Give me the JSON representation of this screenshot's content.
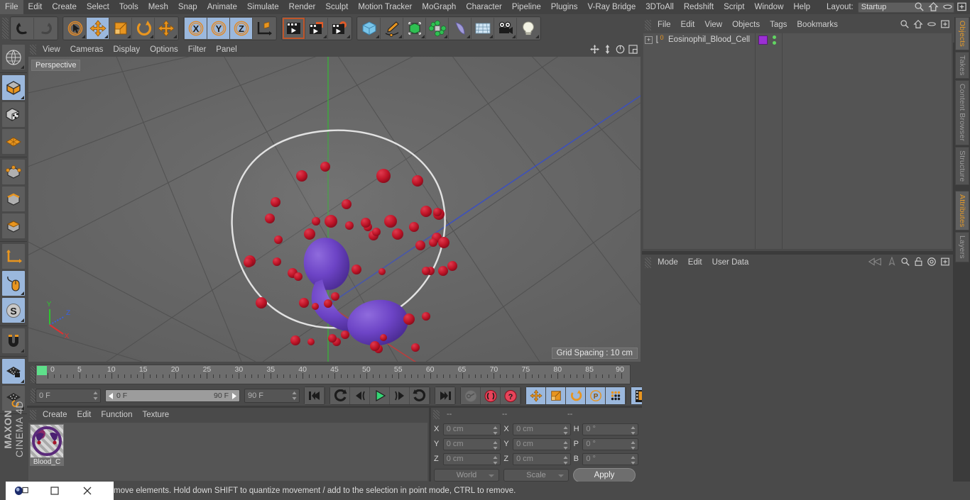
{
  "app": {
    "title": "MAXON CINEMA 4D",
    "brand_line1": "MAXON",
    "brand_line2": "CINEMA 4D"
  },
  "menubar": {
    "items": [
      {
        "label": "File"
      },
      {
        "label": "Edit"
      },
      {
        "label": "Create"
      },
      {
        "label": "Select"
      },
      {
        "label": "Tools"
      },
      {
        "label": "Mesh"
      },
      {
        "label": "Snap"
      },
      {
        "label": "Animate"
      },
      {
        "label": "Simulate"
      },
      {
        "label": "Render"
      },
      {
        "label": "Sculpt"
      },
      {
        "label": "Motion Tracker"
      },
      {
        "label": "MoGraph"
      },
      {
        "label": "Character"
      },
      {
        "label": "Pipeline"
      },
      {
        "label": "Plugins"
      },
      {
        "label": "V-Ray Bridge"
      },
      {
        "label": "3DToAll"
      },
      {
        "label": "Redshift"
      },
      {
        "label": "Script"
      },
      {
        "label": "Window"
      },
      {
        "label": "Help"
      }
    ],
    "layout_label": "Layout:",
    "layout_value": "Startup",
    "right_icons": [
      "search-icon",
      "home-icon",
      "capsule-icon",
      "layout-add-icon"
    ]
  },
  "toolbar": {
    "groups": [
      {
        "name": "history",
        "buttons": [
          {
            "icon": "undo-icon",
            "active": false
          },
          {
            "icon": "redo-icon",
            "active": false
          }
        ]
      },
      {
        "name": "selection-transform",
        "buttons": [
          {
            "icon": "live-selection-icon",
            "active": false
          },
          {
            "icon": "move-icon",
            "active": true
          },
          {
            "icon": "scale-icon",
            "active": false
          },
          {
            "icon": "rotate-icon",
            "active": false
          },
          {
            "icon": "move-alt-icon",
            "active": false
          }
        ]
      },
      {
        "name": "axis-locks",
        "buttons": [
          {
            "icon": "axis-x-icon",
            "active": true
          },
          {
            "icon": "axis-y-icon",
            "active": true
          },
          {
            "icon": "axis-z-icon",
            "active": true
          },
          {
            "icon": "world-object-axis-icon",
            "active": false
          }
        ]
      },
      {
        "name": "render",
        "buttons": [
          {
            "icon": "render-view-icon",
            "active": false
          },
          {
            "icon": "render-to-picture-viewer-icon",
            "active": false
          },
          {
            "icon": "render-settings-icon",
            "active": false
          }
        ]
      },
      {
        "name": "create",
        "buttons": [
          {
            "icon": "cube-primitive-icon",
            "active": false
          },
          {
            "icon": "spline-pen-icon",
            "active": false
          },
          {
            "icon": "nurbs-icon",
            "active": false
          },
          {
            "icon": "array-icon",
            "active": false
          },
          {
            "icon": "bend-deformer-icon",
            "active": false
          },
          {
            "icon": "floor-environment-icon",
            "active": false
          },
          {
            "icon": "camera-icon",
            "active": false
          },
          {
            "icon": "light-icon",
            "active": false
          }
        ]
      }
    ]
  },
  "left_palette": {
    "groups": [
      {
        "buttons": [
          {
            "icon": "make-editable-icon",
            "active": false
          }
        ]
      },
      {
        "buttons": [
          {
            "icon": "model-mode-icon",
            "active": true
          },
          {
            "icon": "texture-mode-icon",
            "active": false
          },
          {
            "icon": "workplane-mode-icon",
            "active": false
          }
        ]
      },
      {
        "buttons": [
          {
            "icon": "points-mode-icon",
            "active": false
          },
          {
            "icon": "edges-mode-icon",
            "active": false
          },
          {
            "icon": "polygons-mode-icon",
            "active": false
          }
        ]
      },
      {
        "buttons": [
          {
            "icon": "axis-modify-icon",
            "active": false
          },
          {
            "icon": "viewport-solo-mouse-icon",
            "active": true
          },
          {
            "icon": "enable-snapping-icon",
            "active": true
          }
        ]
      },
      {
        "buttons": [
          {
            "icon": "magnet-icon",
            "active": false
          }
        ]
      },
      {
        "buttons": [
          {
            "icon": "workplane-lock-icon",
            "active": true
          },
          {
            "icon": "workplane-rotate-icon",
            "active": false
          }
        ]
      }
    ]
  },
  "viewport": {
    "menu": [
      {
        "label": "View"
      },
      {
        "label": "Cameras"
      },
      {
        "label": "Display"
      },
      {
        "label": "Options"
      },
      {
        "label": "Filter"
      },
      {
        "label": "Panel"
      }
    ],
    "icons": [
      "pan-icon",
      "dolly-icon",
      "orbit-icon",
      "maximize-view-icon"
    ],
    "label": "Perspective",
    "grid_spacing": "Grid Spacing : 10 cm",
    "axis_gizmo": {
      "x": "X",
      "y": "Y",
      "z": "Z"
    },
    "scene": {
      "name": "Eosinophil Blood Cell",
      "nucleus_color": "#6b3fc4",
      "granule_color": "#c41830",
      "membrane_color": "#e8e8e8",
      "background_color": "#666666",
      "granule_count": 54
    }
  },
  "timeline": {
    "ruler_ticks": [
      0,
      5,
      10,
      15,
      20,
      25,
      30,
      35,
      40,
      45,
      50,
      55,
      60,
      65,
      70,
      75,
      80,
      85,
      90
    ],
    "current_frame_field": "0 F",
    "current_frame_right": "0 F",
    "range_start": "0 F",
    "range_end": "90 F",
    "max_frame": "90 F",
    "transport": [
      {
        "icon": "go-to-start-icon"
      },
      {
        "icon": "play-backwards-loop-icon"
      },
      {
        "icon": "step-back-icon"
      },
      {
        "icon": "play-icon"
      },
      {
        "icon": "step-forward-icon"
      },
      {
        "icon": "play-forward-loop-icon"
      },
      {
        "icon": "go-to-end-icon"
      }
    ],
    "keyframe_tools": [
      {
        "icon": "autokey-record-icon"
      },
      {
        "icon": "record-active-objects-icon"
      },
      {
        "icon": "keyframe-selection-icon"
      }
    ],
    "key_axis_tools": [
      {
        "icon": "position-key-icon",
        "active": true
      },
      {
        "icon": "scale-key-icon",
        "active": true
      },
      {
        "icon": "rotation-key-icon",
        "active": true
      },
      {
        "icon": "parameter-key-icon",
        "active": true
      },
      {
        "icon": "pla-key-icon",
        "active": true
      }
    ],
    "film_button": {
      "icon": "timeline-film-icon",
      "active": true
    }
  },
  "material_manager": {
    "menu": [
      {
        "label": "Create"
      },
      {
        "label": "Edit"
      },
      {
        "label": "Function"
      },
      {
        "label": "Texture"
      }
    ],
    "materials": [
      {
        "name": "Blood_C",
        "color": "#6b2f7a"
      }
    ]
  },
  "coordinates": {
    "header": [
      "--",
      "--",
      "--"
    ],
    "rows": [
      {
        "pos_label": "X",
        "pos_value": "0 cm",
        "size_label": "X",
        "size_value": "0 cm",
        "rot_label": "H",
        "rot_value": "0 °"
      },
      {
        "pos_label": "Y",
        "pos_value": "0 cm",
        "size_label": "Y",
        "size_value": "0 cm",
        "rot_label": "P",
        "rot_value": "0 °"
      },
      {
        "pos_label": "Z",
        "pos_value": "0 cm",
        "size_label": "Z",
        "size_value": "0 cm",
        "rot_label": "B",
        "rot_value": "0 °"
      }
    ],
    "space_dropdown": "World",
    "mode_dropdown": "Scale",
    "apply_button": "Apply"
  },
  "object_manager": {
    "menu": [
      {
        "label": "File"
      },
      {
        "label": "Edit"
      },
      {
        "label": "View"
      },
      {
        "label": "Objects"
      },
      {
        "label": "Tags"
      },
      {
        "label": "Bookmarks"
      }
    ],
    "icons": [
      "search-icon",
      "home-icon",
      "capsule-icon",
      "add-layer-icon"
    ],
    "objects": [
      {
        "name": "Eosinophil_Blood_Cell",
        "badge": "0",
        "material_color": "#9b2fd4",
        "visible_dots": 2
      }
    ]
  },
  "attributes": {
    "menu": [
      {
        "label": "Mode"
      },
      {
        "label": "Edit"
      },
      {
        "label": "User Data"
      }
    ],
    "icons": [
      "history-back-icon",
      "pin-icon",
      "search-icon",
      "lock-icon",
      "target-icon",
      "add-icon"
    ]
  },
  "right_tabs": {
    "upper": [
      {
        "label": "Objects",
        "active": true
      },
      {
        "label": "Takes",
        "active": false
      },
      {
        "label": "Content Browser",
        "active": false
      },
      {
        "label": "Structure",
        "active": false
      }
    ],
    "lower": [
      {
        "label": "Attributes",
        "active": true
      },
      {
        "label": "Layers",
        "active": false
      }
    ]
  },
  "statusbar": {
    "message": "move elements. Hold down SHIFT to quantize movement / add to the selection in point mode, CTRL to remove.",
    "window_controls": [
      {
        "icon": "restore-icon"
      },
      {
        "icon": "maximize-icon"
      },
      {
        "icon": "close-icon"
      }
    ]
  }
}
